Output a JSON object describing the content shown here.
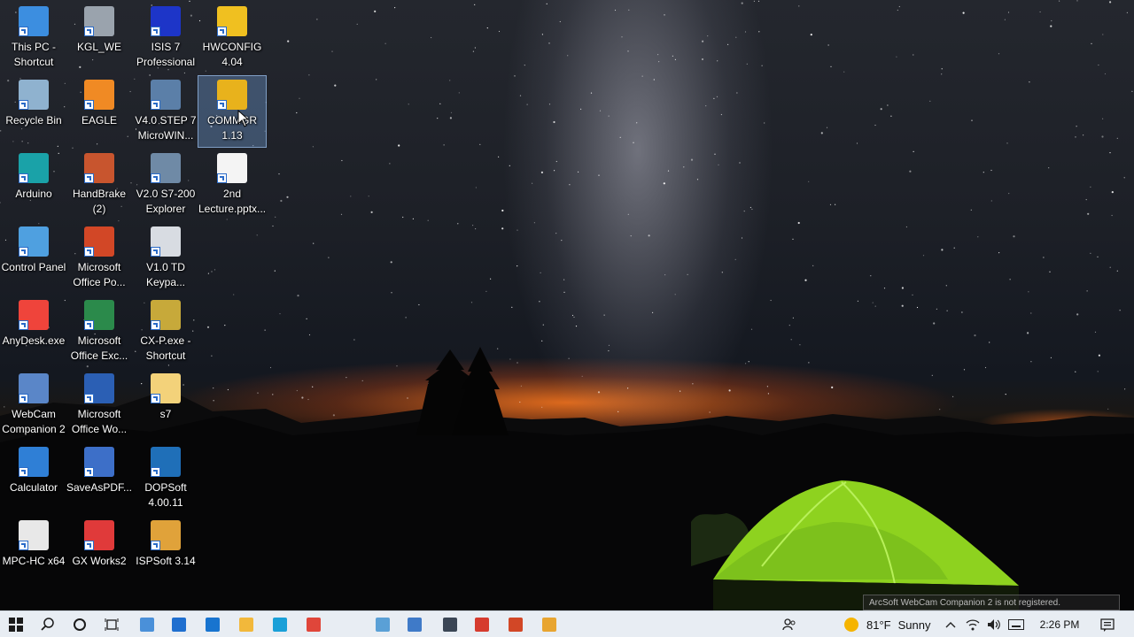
{
  "desktop": {
    "icons": [
      {
        "label": "This PC -\nShortcut",
        "icon": "this-pc-icon",
        "color": "#3c8ee0"
      },
      {
        "label": "Recycle Bin",
        "icon": "recycle-bin-icon",
        "color": "#8fb2cf"
      },
      {
        "label": "Arduino",
        "icon": "arduino-icon",
        "color": "#1aa2a8"
      },
      {
        "label": "Control Panel",
        "icon": "control-panel-icon",
        "color": "#4fa0e0"
      },
      {
        "label": "AnyDesk.exe",
        "icon": "anydesk-icon",
        "color": "#ef443b"
      },
      {
        "label": "WebCam\nCompanion 2",
        "icon": "webcam-icon",
        "color": "#5a86c8"
      },
      {
        "label": "Calculator",
        "icon": "calculator-icon",
        "color": "#2f7fd6"
      },
      {
        "label": "MPC-HC x64",
        "icon": "mpc-hc-icon",
        "color": "#e8e8e8"
      },
      {
        "label": "KGL_WE",
        "icon": "kgl-we-icon",
        "color": "#9aa3ad"
      },
      {
        "label": "EAGLE",
        "icon": "eagle-icon",
        "color": "#f08a24"
      },
      {
        "label": "HandBrake\n(2)",
        "icon": "handbrake-icon",
        "color": "#c8552e"
      },
      {
        "label": "Microsoft\nOffice Po...",
        "icon": "powerpoint-icon",
        "color": "#d24726"
      },
      {
        "label": "Microsoft\nOffice Exc...",
        "icon": "excel-icon",
        "color": "#2b8a4b"
      },
      {
        "label": "Microsoft\nOffice Wo...",
        "icon": "word-icon",
        "color": "#2b5fb4"
      },
      {
        "label": "SaveAsPDF...",
        "icon": "save-as-pdf-icon",
        "color": "#3d6fc8"
      },
      {
        "label": "GX Works2",
        "icon": "gx-works-icon",
        "color": "#e03a3a"
      },
      {
        "label": "ISIS 7\nProfessional",
        "icon": "isis-icon",
        "color": "#1d35c8"
      },
      {
        "label": "V4.0 STEP 7\nMicroWIN...",
        "icon": "step7-microwin-icon",
        "color": "#5b7fa8"
      },
      {
        "label": "V2.0 S7-200\nExplorer",
        "icon": "s7-200-explorer-icon",
        "color": "#6f8aa6"
      },
      {
        "label": "V1.0 TD\nKeypa...",
        "icon": "td-keypad-icon",
        "color": "#d8dce2"
      },
      {
        "label": "CX-P.exe -\nShortcut",
        "icon": "cx-programmer-icon",
        "color": "#c7a93a"
      },
      {
        "label": "s7",
        "icon": "folder-icon",
        "color": "#f3d27a"
      },
      {
        "label": "DOPSoft\n4.00.11",
        "icon": "dopsoft-icon",
        "color": "#1f6fb8"
      },
      {
        "label": "ISPSoft 3.14",
        "icon": "ispsoft-icon",
        "color": "#e0a23a"
      },
      {
        "label": "HWCONFIG\n4.04",
        "icon": "hwconfig-icon",
        "color": "#f0c020"
      },
      {
        "label": "COMMGR\n1.13",
        "icon": "commgr-icon",
        "color": "#e8b21c",
        "selected": true
      },
      {
        "label": "2nd\nLecture.pptx...",
        "icon": "pptx-file-icon",
        "color": "#f4f4f4"
      }
    ]
  },
  "taskbar": {
    "items": [
      {
        "name": "start-button",
        "icon": "windows-logo-icon",
        "color": "#1b1b1b"
      },
      {
        "name": "search-button",
        "icon": "search-icon",
        "color": "#1b1b1b"
      },
      {
        "name": "cortana-button",
        "icon": "cortana-icon",
        "color": "#1b1b1b"
      },
      {
        "name": "task-view-button",
        "icon": "task-view-icon",
        "color": "#1b1b1b"
      },
      {
        "name": "taskbar-app-1",
        "icon": "app-icon",
        "color": "#4a90d9"
      },
      {
        "name": "taskbar-store",
        "icon": "store-icon",
        "color": "#1f6fcf"
      },
      {
        "name": "taskbar-mail",
        "icon": "mail-icon",
        "color": "#1874cf"
      },
      {
        "name": "taskbar-file-explorer",
        "icon": "folder-icon",
        "color": "#f2b83b"
      },
      {
        "name": "taskbar-edge",
        "icon": "edge-icon",
        "color": "#1aa0d8"
      },
      {
        "name": "taskbar-chrome",
        "icon": "chrome-icon",
        "color": "#e0463a"
      },
      {
        "name": "taskbar-app-2",
        "icon": "app-icon",
        "color": "#5aa0d6"
      },
      {
        "name": "taskbar-webcam",
        "icon": "webcam-icon",
        "color": "#3f7ac8"
      },
      {
        "name": "taskbar-logo",
        "icon": "logo-icon",
        "color": "#3b4655"
      },
      {
        "name": "taskbar-app-3",
        "icon": "app-icon",
        "color": "#d63b2e"
      },
      {
        "name": "taskbar-powerpoint",
        "icon": "powerpoint-icon",
        "color": "#d24726"
      },
      {
        "name": "taskbar-app-4",
        "icon": "app-icon",
        "color": "#e8a530"
      }
    ],
    "weather": {
      "temp": "81°F",
      "condition": "Sunny",
      "icon": "sun-icon",
      "color": "#f5b400"
    },
    "time": "2:26 PM"
  },
  "watermark": {
    "text": "ArcSoft WebCam Companion 2 is not registered."
  }
}
